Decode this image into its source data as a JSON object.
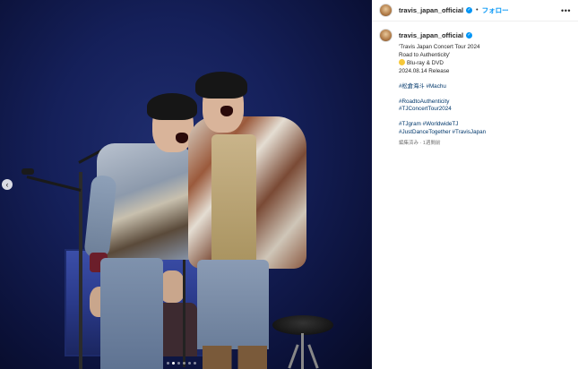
{
  "post": {
    "username": "travis_japan_official",
    "separator": "•",
    "follow_label": "フォロー",
    "more_icon": "•••",
    "caption_lines": [
      "'Travis Japan Concert Tour 2024",
      "Road to Authenticity'",
      "Blu-ray & DVD",
      "2024.08.14 Release"
    ],
    "hashtags_1": "#松倉海斗 #Machu",
    "hashtags_2": "#RoadtoAuthenticity",
    "hashtags_3": "#TJConcertTour2024",
    "hashtags_4": "#TJgram #WorldwideTJ",
    "hashtags_5": "#JustDanceTogether #TravisJapan",
    "meta": "編集済み · 1週間前"
  },
  "carousel": {
    "prev_icon": "‹",
    "dot_count": 6,
    "active_dot": 2
  },
  "colors": {
    "accent": "#0095f6",
    "hashtag": "#00376b",
    "stage_background": "#15205a"
  }
}
